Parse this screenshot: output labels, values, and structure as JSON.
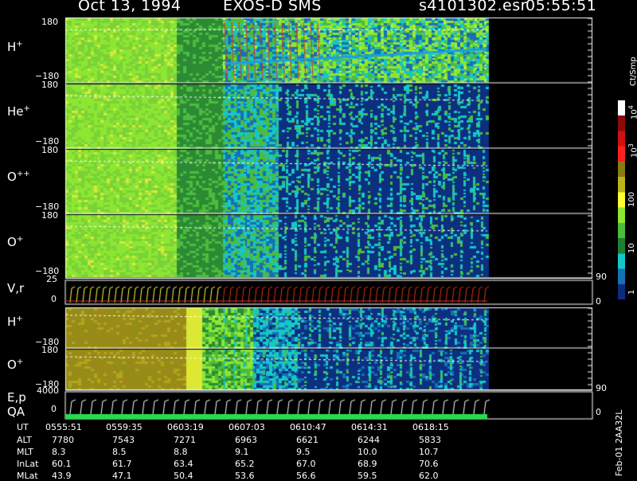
{
  "header": {
    "date": "Oct 13, 1994",
    "instrument": "EXOS-D SMS",
    "file": "s4101302.esr",
    "time": "05:55:51"
  },
  "panels": [
    {
      "label_main": "H",
      "label_sup": "+",
      "ymax": "180",
      "ymin": "−180"
    },
    {
      "label_main": "He",
      "label_sup": "+",
      "ymax": "180",
      "ymin": "−180"
    },
    {
      "label_main": "O",
      "label_sup": "++",
      "ymax": "180",
      "ymin": "−180"
    },
    {
      "label_main": "O",
      "label_sup": "+",
      "ymax": "180",
      "ymin": "−180"
    },
    {
      "label_main": "V,r",
      "label_sup": "",
      "ymax": "25",
      "ymin": "0",
      "right_top": "90",
      "right_bottom": "0"
    },
    {
      "label_main": "H",
      "label_sup": "+",
      "ymax": "180",
      "ymin": "−180"
    },
    {
      "label_main": "O",
      "label_sup": "+",
      "ymax": "180",
      "ymin": "−180"
    },
    {
      "label_main": "E,p",
      "label2": "QA",
      "label_sup": "",
      "ymax": "4000",
      "ymin": "0",
      "right_top": "90",
      "right_bottom": "0"
    }
  ],
  "colorbar": {
    "unit": "Ct/Smp",
    "ticks": [
      {
        "base": "10",
        "exp": "4"
      },
      {
        "base": "10",
        "exp": "3"
      },
      {
        "base": "100",
        "exp": ""
      },
      {
        "base": "10",
        "exp": ""
      },
      {
        "base": "1",
        "exp": ""
      }
    ],
    "colors": [
      "#ffffff",
      "#8b0a0a",
      "#d01010",
      "#ff2020",
      "#8a7a14",
      "#b8b41e",
      "#ffff30",
      "#8ce632",
      "#4cbc3c",
      "#1f7f32",
      "#14c8c8",
      "#1670b4",
      "#0c2c7c"
    ]
  },
  "footer": {
    "rows": [
      {
        "label": "UT",
        "values": [
          "0555:51",
          "0559:35",
          "0603:19",
          "0607:03",
          "0610:47",
          "0614:31",
          "0618:15"
        ]
      },
      {
        "label": "ALT",
        "values": [
          "7780",
          "7543",
          "7271",
          "6963",
          "6621",
          "6244",
          "5833"
        ]
      },
      {
        "label": "MLT",
        "values": [
          "8.3",
          "8.5",
          "8.8",
          "9.1",
          "9.5",
          "10.0",
          "10.7"
        ]
      },
      {
        "label": "InLat",
        "values": [
          "60.1",
          "61.7",
          "63.4",
          "65.2",
          "67.0",
          "68.9",
          "70.6"
        ]
      },
      {
        "label": "MLat",
        "values": [
          "43.9",
          "47.1",
          "50.4",
          "53.6",
          "56.6",
          "59.5",
          "62.0"
        ]
      }
    ],
    "stamp": "Feb-01 2AA32L"
  },
  "chart_data": {
    "type": "heatmap",
    "title": "Oct 13, 1994   EXOS-D SMS   s4101302.esr   05:55:51",
    "colorbar_range": [
      1,
      10000
    ],
    "colorbar_scale": "log",
    "colorbar_unit": "Ct/Smp",
    "x_ticks_ut": [
      "0555:51",
      "0559:35",
      "0603:19",
      "0607:03",
      "0610:47",
      "0614:31",
      "0618:15"
    ],
    "panels": [
      {
        "name": "H+",
        "ylim": [
          -180,
          180
        ]
      },
      {
        "name": "He+",
        "ylim": [
          -180,
          180
        ]
      },
      {
        "name": "O++",
        "ylim": [
          -180,
          180
        ]
      },
      {
        "name": "O+",
        "ylim": [
          -180,
          180
        ]
      },
      {
        "name": "V,r",
        "ylim": [
          0,
          25
        ],
        "right_axis": [
          0,
          90
        ]
      },
      {
        "name": "H+",
        "ylim": [
          -180,
          180
        ]
      },
      {
        "name": "O+",
        "ylim": [
          -180,
          180
        ]
      },
      {
        "name": "E,p",
        "ylim": [
          0,
          4000
        ],
        "right_axis": [
          0,
          90
        ]
      }
    ]
  }
}
